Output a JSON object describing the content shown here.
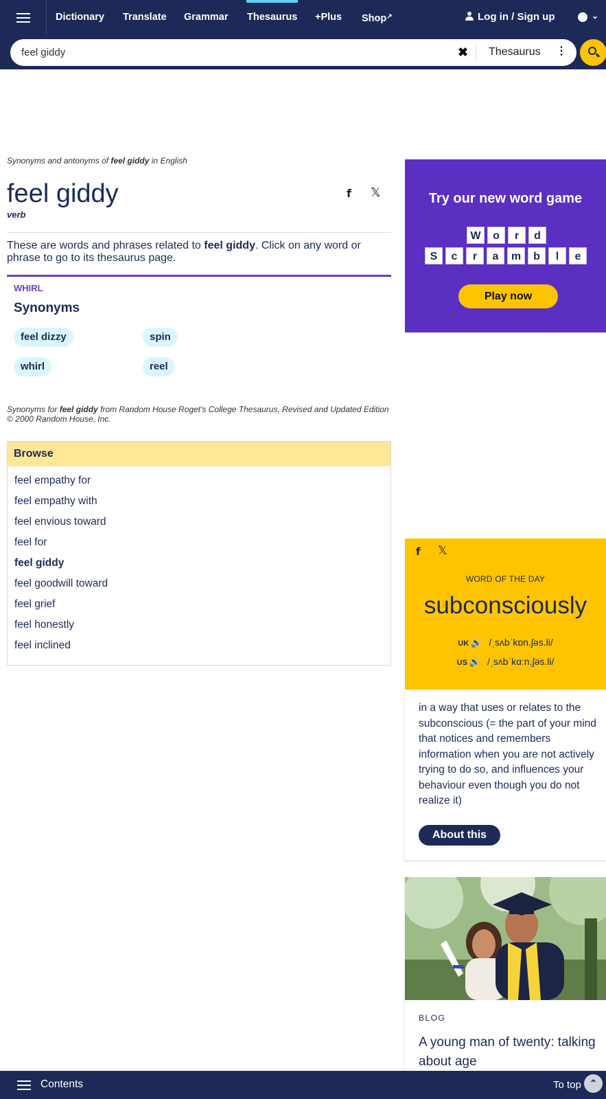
{
  "nav": {
    "items": [
      "Dictionary",
      "Translate",
      "Grammar",
      "Thesaurus",
      "+Plus",
      "Shop"
    ],
    "active": "Thesaurus",
    "login": "Log in / Sign up"
  },
  "search": {
    "value": "feel giddy",
    "dictionary": "Thesaurus"
  },
  "entry": {
    "crumb_prefix": "Synonyms and antonyms of",
    "crumb_word": "feel giddy",
    "crumb_suffix": "in English",
    "headword": "feel giddy",
    "pos": "verb",
    "intro_prefix": "These are words and phrases related to",
    "intro_word": "feel giddy",
    "intro_suffix": ". Click on any word or phrase to go to its thesaurus page.",
    "sense_label": "WHIRL",
    "synonyms_heading": "Synonyms",
    "synonyms": [
      "feel dizzy",
      "spin",
      "whirl",
      "reel"
    ],
    "source_prefix": "Synonyms for",
    "source_word": "feel giddy",
    "source_suffix": "from Random House Roget's College Thesaurus, Revised and Updated Edition © 2000 Random House, Inc."
  },
  "browse": {
    "heading": "Browse",
    "items": [
      "feel empathy for",
      "feel empathy with",
      "feel envious toward",
      "feel for",
      "feel giddy",
      "feel goodwill toward",
      "feel grief",
      "feel honestly",
      "feel inclined"
    ],
    "current_index": 4
  },
  "promo": {
    "title": "Try our new word game",
    "row1": [
      "W",
      "o",
      "r",
      "d"
    ],
    "row2": [
      "S",
      "c",
      "r",
      "a",
      "m",
      "b",
      "l",
      "e"
    ],
    "button": "Play now"
  },
  "wotd": {
    "label": "WORD OF THE DAY",
    "word": "subconsciously",
    "uk_label": "UK",
    "uk_ipa": "/ˌsʌbˈkɒn.ʃəs.li/",
    "us_label": "US",
    "us_ipa": "/ˌsʌbˈkɑːn.ʃəs.li/",
    "definition": "in a way that uses or relates to the subconscious (= the part of your mind that notices and remembers information when you are not actively trying to do so, and influences your behaviour even though you do not realize it)",
    "button": "About this"
  },
  "blog": {
    "kicker": "BLOG",
    "title": "A young man of twenty: talking about age"
  },
  "bottom": {
    "contents": "Contents",
    "totop": "To top"
  },
  "colors": {
    "navy": "#1d2a57",
    "yellow": "#fec400",
    "purple": "#5a2fc2",
    "pill": "#daf6fd",
    "browse_head": "#fee797"
  }
}
